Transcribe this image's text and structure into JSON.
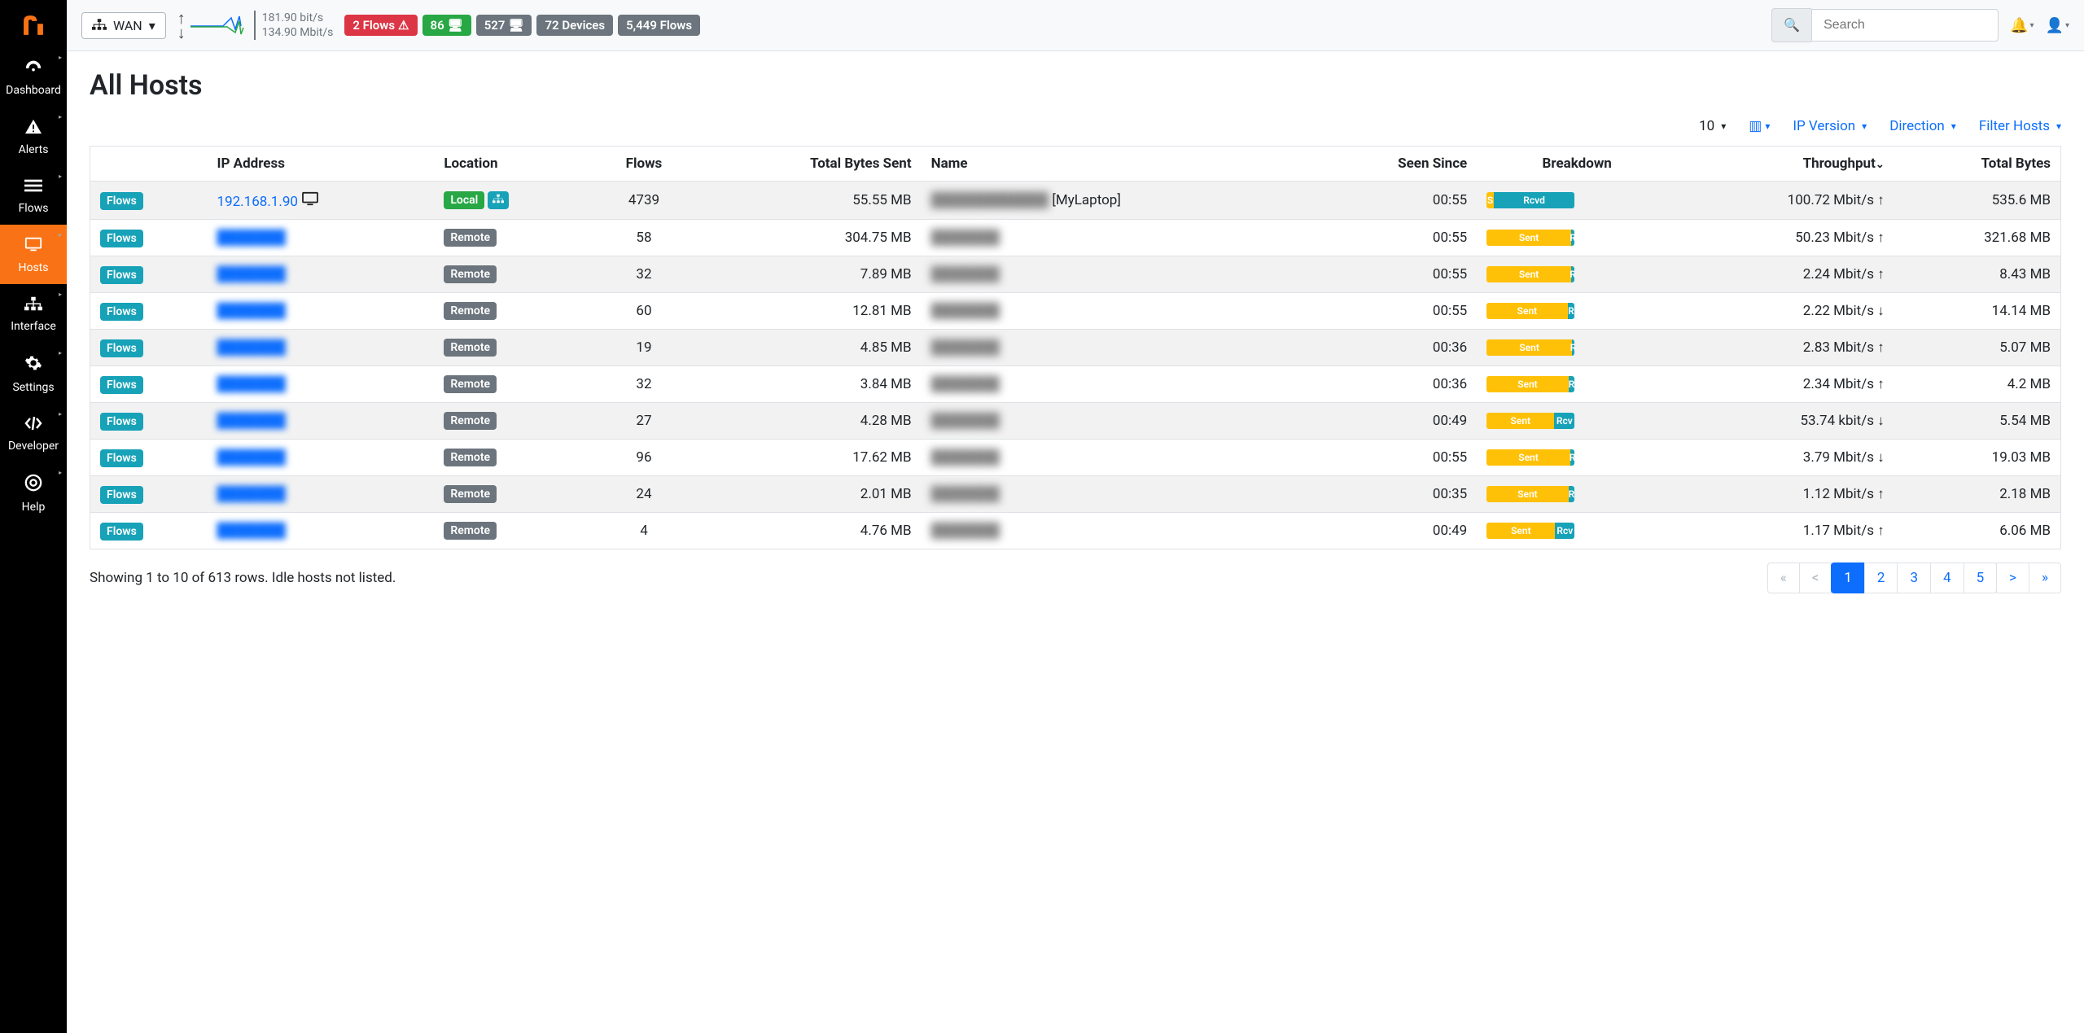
{
  "sidebar": {
    "items": [
      {
        "label": "Dashboard",
        "icon": "dashboard"
      },
      {
        "label": "Alerts",
        "icon": "alert"
      },
      {
        "label": "Flows",
        "icon": "flows"
      },
      {
        "label": "Hosts",
        "icon": "hosts",
        "active": true
      },
      {
        "label": "Interface",
        "icon": "interface"
      },
      {
        "label": "Settings",
        "icon": "settings"
      },
      {
        "label": "Developer",
        "icon": "developer"
      },
      {
        "label": "Help",
        "icon": "help"
      }
    ]
  },
  "topbar": {
    "interface_label": "WAN",
    "throughput_up": "181.90 bit/s",
    "throughput_down": "134.90 Mbit/s",
    "badges": {
      "flows_alert": "2 Flows",
      "ok": "86",
      "count1": "527",
      "devices": "72 Devices",
      "flows": "5,449 Flows"
    },
    "search_placeholder": "Search"
  },
  "page": {
    "title": "All Hosts"
  },
  "toolbar": {
    "rows": "10",
    "ip_version": "IP Version",
    "direction": "Direction",
    "filter_hosts": "Filter Hosts"
  },
  "columns": {
    "flows_btn": "Flows",
    "ip": "IP Address",
    "location": "Location",
    "flows": "Flows",
    "bytes_sent": "Total Bytes Sent",
    "name": "Name",
    "seen_since": "Seen Since",
    "breakdown": "Breakdown",
    "throughput": "Throughput",
    "total_bytes": "Total Bytes"
  },
  "location_labels": {
    "local": "Local",
    "remote": "Remote"
  },
  "breakdown_labels": {
    "sent": "Sent",
    "rcvd": "Rcvd",
    "rcv": "Rcv",
    "s": "S",
    "r": "R"
  },
  "rows": [
    {
      "ip": "192.168.1.90",
      "ip_clear": true,
      "os_icons": true,
      "location": "local",
      "flows": "4739",
      "bytes_sent": "55.55 MB",
      "name": "[MyLaptop]",
      "name_prefix_blur": true,
      "seen": "00:55",
      "sent_pct": 8,
      "bd_left": "S",
      "bd_right": "Rcvd",
      "throughput": "100.72 Mbit/s",
      "dir": "up",
      "total": "535.6 MB"
    },
    {
      "ip": "███████",
      "location": "remote",
      "flows": "58",
      "bytes_sent": "304.75 MB",
      "name": "███████",
      "seen": "00:55",
      "sent_pct": 96,
      "bd_left": "Sent",
      "bd_right": "R",
      "throughput": "50.23 Mbit/s",
      "dir": "up",
      "total": "321.68 MB"
    },
    {
      "ip": "███████",
      "location": "remote",
      "flows": "32",
      "bytes_sent": "7.89 MB",
      "name": "███████",
      "seen": "00:55",
      "sent_pct": 96,
      "bd_left": "Sent",
      "bd_right": "R",
      "throughput": "2.24 Mbit/s",
      "dir": "up",
      "total": "8.43 MB"
    },
    {
      "ip": "███████",
      "location": "remote",
      "flows": "60",
      "bytes_sent": "12.81 MB",
      "name": "███████",
      "seen": "00:55",
      "sent_pct": 92,
      "bd_left": "Sent",
      "bd_right": "R",
      "throughput": "2.22 Mbit/s",
      "dir": "down",
      "total": "14.14 MB"
    },
    {
      "ip": "███████",
      "location": "remote",
      "flows": "19",
      "bytes_sent": "4.85 MB",
      "name": "███████",
      "seen": "00:36",
      "sent_pct": 97,
      "bd_left": "Sent",
      "bd_right": "R",
      "throughput": "2.83 Mbit/s",
      "dir": "up",
      "total": "5.07 MB"
    },
    {
      "ip": "███████",
      "location": "remote",
      "flows": "32",
      "bytes_sent": "3.84 MB",
      "name": "███████",
      "seen": "00:36",
      "sent_pct": 93,
      "bd_left": "Sent",
      "bd_right": "R",
      "throughput": "2.34 Mbit/s",
      "dir": "up",
      "total": "4.2 MB"
    },
    {
      "ip": "███████",
      "location": "remote",
      "flows": "27",
      "bytes_sent": "4.28 MB",
      "name": "███████",
      "seen": "00:49",
      "sent_pct": 77,
      "bd_left": "Sent",
      "bd_right": "Rcv",
      "throughput": "53.74 kbit/s",
      "dir": "down",
      "total": "5.54 MB"
    },
    {
      "ip": "███████",
      "location": "remote",
      "flows": "96",
      "bytes_sent": "17.62 MB",
      "name": "███████",
      "seen": "00:55",
      "sent_pct": 95,
      "bd_left": "Sent",
      "bd_right": "R",
      "throughput": "3.79 Mbit/s",
      "dir": "down",
      "total": "19.03 MB"
    },
    {
      "ip": "███████",
      "location": "remote",
      "flows": "24",
      "bytes_sent": "2.01 MB",
      "name": "███████",
      "seen": "00:35",
      "sent_pct": 93,
      "bd_left": "Sent",
      "bd_right": "R",
      "throughput": "1.12 Mbit/s",
      "dir": "up",
      "total": "2.18 MB"
    },
    {
      "ip": "███████",
      "location": "remote",
      "flows": "4",
      "bytes_sent": "4.76 MB",
      "name": "███████",
      "seen": "00:49",
      "sent_pct": 78,
      "bd_left": "Sent",
      "bd_right": "Rcv",
      "throughput": "1.17 Mbit/s",
      "dir": "up",
      "total": "6.06 MB"
    }
  ],
  "footer": {
    "summary": "Showing 1 to 10 of 613 rows. Idle hosts not listed.",
    "pages": [
      "1",
      "2",
      "3",
      "4",
      "5"
    ],
    "current_page": "1"
  }
}
